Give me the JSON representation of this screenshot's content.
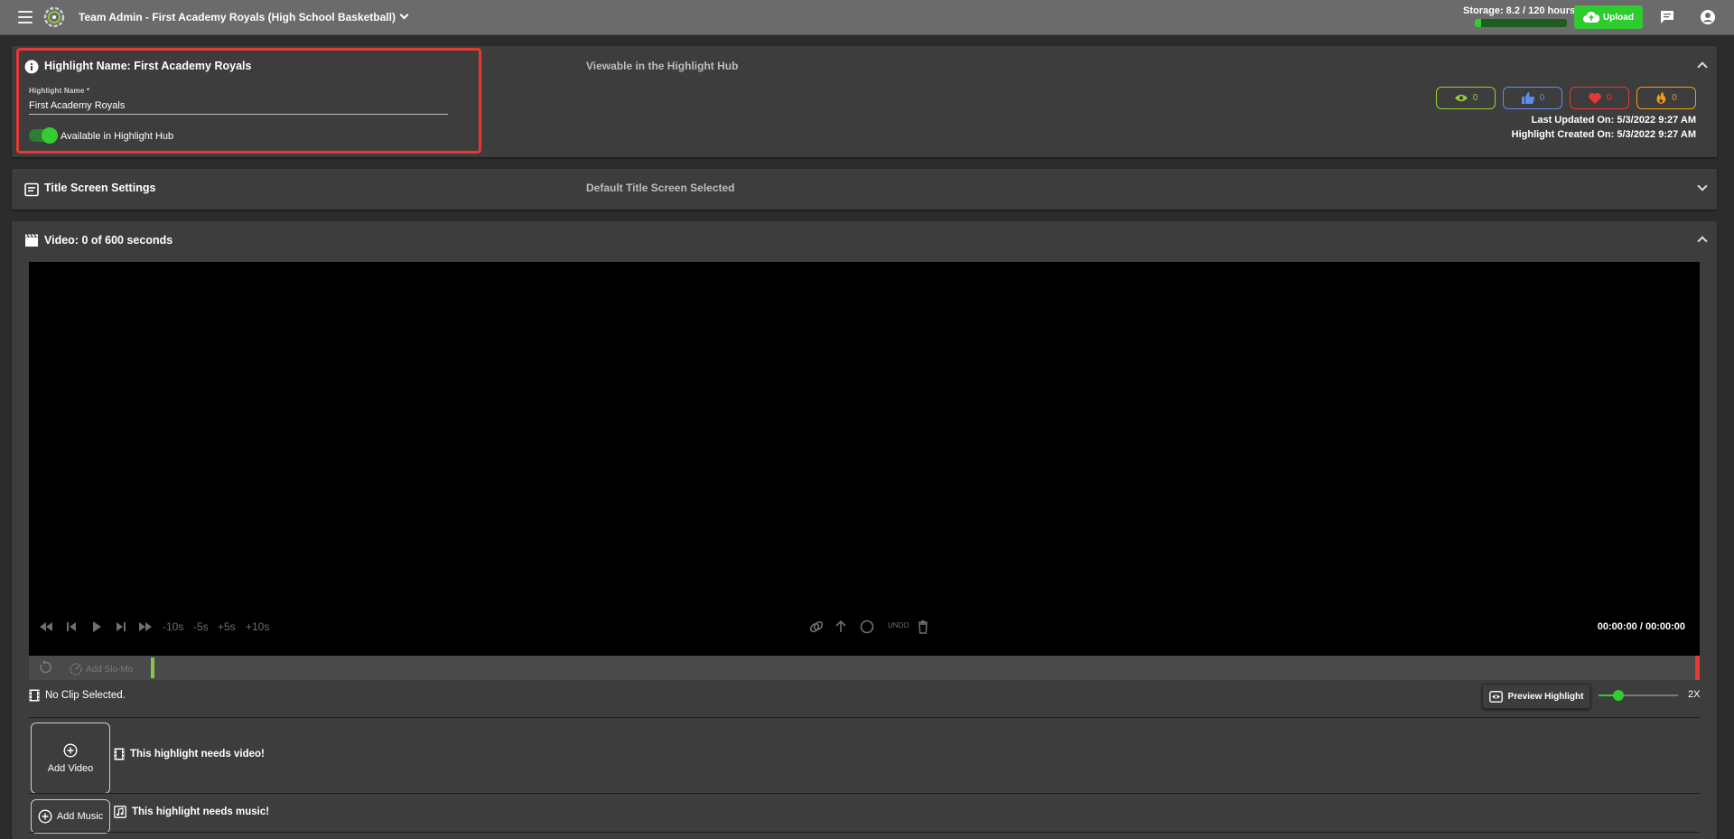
{
  "topbar": {
    "team_title": "Team Admin - First Academy Royals (High School Basketball)",
    "storage_label": "Storage: 8.2 / 120 hours",
    "storage_used_fraction": 0.068,
    "upload_label": "Upload"
  },
  "highlight": {
    "title": "Highlight Name: First Academy Royals",
    "status": "Viewable in the Highlight Hub",
    "field_label": "Highlight Name *",
    "field_value": "First Academy Royals",
    "toggle_label": "Available in Highlight Hub",
    "toggle_on": true,
    "stats": {
      "views": "0",
      "likes": "0",
      "loves": "0",
      "fire": "0"
    },
    "last_updated": "Last Updated On: 5/3/2022 9:27 AM",
    "created": "Highlight Created On: 5/3/2022 9:27 AM"
  },
  "title_screen": {
    "title": "Title Screen Settings",
    "status": "Default Title Screen Selected"
  },
  "video": {
    "title": "Video: 0 of 600 seconds",
    "controls": {
      "minus10": "-10s",
      "minus5": "-5s",
      "plus5": "+5s",
      "plus10": "+10s",
      "undo": "UNDO"
    },
    "timecode": "00:00:00 / 00:00:00",
    "slomo_label": "Add Slo-Mo",
    "no_clip": "No Clip Selected.",
    "preview_label": "Preview Highlight",
    "speed_label": "2X",
    "speed_fraction": 0.25,
    "add_video_label": "Add Video",
    "needs_video": "This highlight needs video!",
    "add_music_label": "Add Music",
    "needs_music": "This highlight needs music!"
  },
  "colors": {
    "accent_green": "#33cc33",
    "views": "#9acd32",
    "likes": "#5b8def",
    "loves": "#e53935",
    "fire": "#f39c12",
    "highlight_border": "#e53935"
  }
}
